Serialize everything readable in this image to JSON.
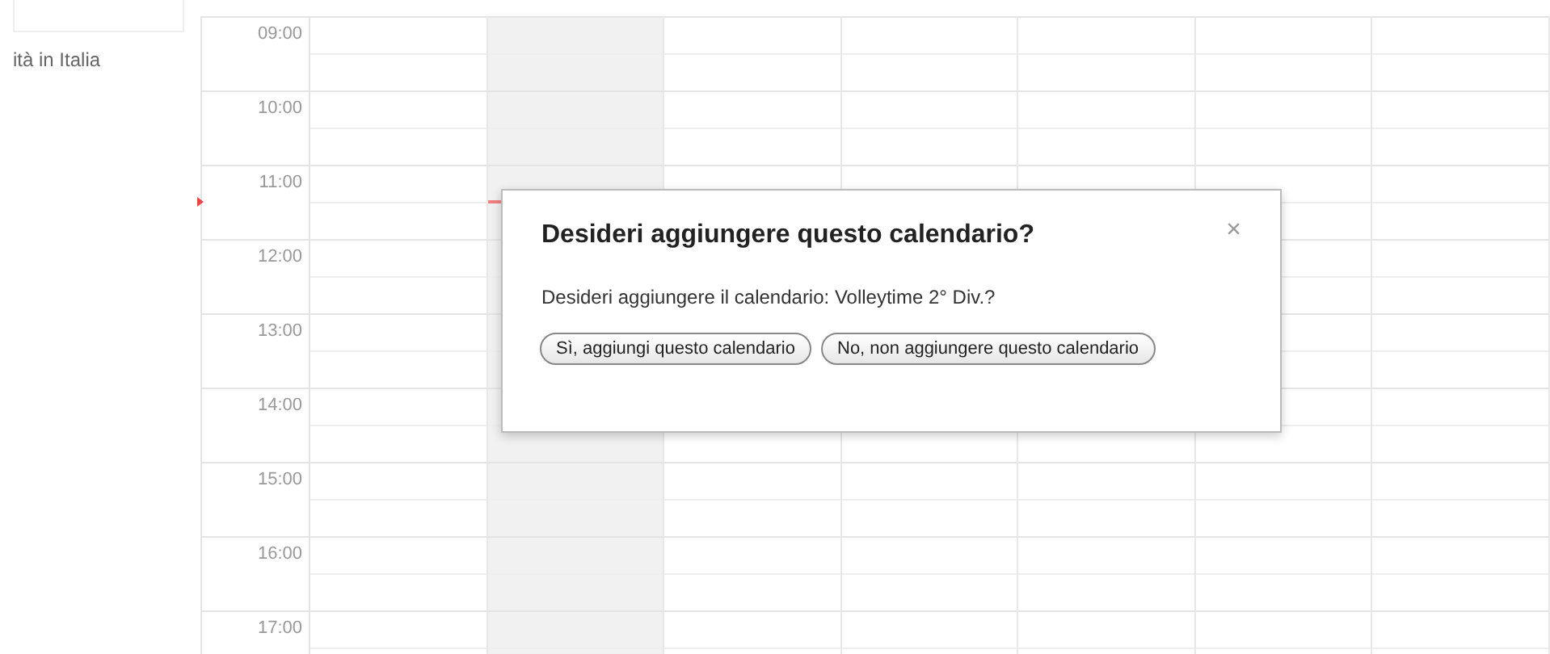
{
  "sidebar": {
    "items": [
      {
        "label": "ità in Italia"
      }
    ]
  },
  "calendar": {
    "hours": [
      "09:00",
      "10:00",
      "11:00",
      "12:00",
      "13:00",
      "14:00",
      "15:00",
      "16:00",
      "17:00"
    ],
    "days": [
      {
        "today": false
      },
      {
        "today": true
      },
      {
        "today": false
      },
      {
        "today": false
      },
      {
        "today": false
      },
      {
        "today": false
      },
      {
        "today": false
      }
    ]
  },
  "dialog": {
    "title": "Desideri aggiungere questo calendario?",
    "close": "×",
    "message": "Desideri aggiungere il calendario: Volleytime 2° Div.?",
    "buttons": [
      {
        "label": "Sì, aggiungi questo calendario"
      },
      {
        "label": "No, non aggiungere questo calendario"
      }
    ]
  }
}
